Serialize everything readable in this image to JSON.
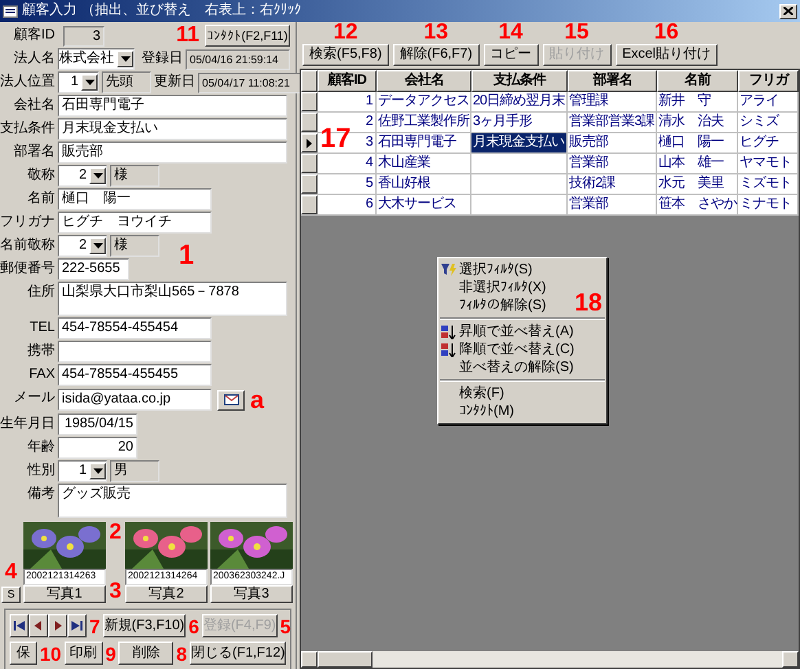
{
  "window": {
    "title": "顧客入力 （抽出、並び替え　右表上：右ｸﾘｯｸ"
  },
  "header": {
    "id_label": "顧客ID",
    "id_value": "3",
    "contact_button": "ｺﾝﾀｸﾄ(F2,F11)",
    "corp_label": "法人名",
    "corp_value": "株式会社",
    "reg_label": "登録日",
    "reg_value": "05/04/16 21:59:14",
    "pos_label": "法人位置",
    "pos_value": "1",
    "pos_text": "先頭",
    "upd_label": "更新日",
    "upd_value": "05/04/17 11:08:21"
  },
  "fields": [
    {
      "label": "会社名",
      "value": "石田専門電子",
      "kind": "long"
    },
    {
      "label": "支払条件",
      "value": "月末現金支払い",
      "kind": "long"
    },
    {
      "label": "部署名",
      "value": "販売部",
      "kind": "long"
    },
    {
      "label": "敬称",
      "value": "2",
      "text": "様",
      "kind": "combo"
    },
    {
      "label": "名前",
      "value": "樋口　陽一",
      "kind": "medium"
    },
    {
      "label": "フリガナ",
      "value": "ヒグチ　ヨウイチ",
      "kind": "medium"
    },
    {
      "label": "名前敬称",
      "value": "2",
      "text": "様",
      "kind": "combo"
    },
    {
      "label": "郵便番号",
      "value": "222-5655",
      "kind": "short"
    },
    {
      "label": "住所",
      "value": "山梨県大口市梨山565－7878",
      "kind": "area"
    },
    {
      "label": "TEL",
      "value": "454-78554-455454",
      "kind": "medium"
    },
    {
      "label": "携帯",
      "kind": "medium"
    },
    {
      "label": "FAX",
      "value": "454-78554-455455",
      "kind": "medium"
    },
    {
      "label": "メール",
      "value": "isida@yataa.co.jp",
      "kind": "mail"
    },
    {
      "label": "生年月日",
      "value": "1985/04/15",
      "kind": "number"
    },
    {
      "label": "年齢",
      "value": "20",
      "kind": "number"
    },
    {
      "label": "性別",
      "value": "1",
      "text": "男",
      "kind": "combo"
    },
    {
      "label": "備考",
      "value": "グッズ販売",
      "kind": "area"
    }
  ],
  "photos": [
    {
      "file": "2002121314263",
      "button": "写真1"
    },
    {
      "file": "2002121314264",
      "button": "写真2"
    },
    {
      "file": "200362303242.J",
      "button": "写真3"
    }
  ],
  "s_button": "S",
  "buttons": [
    {
      "label": "新規(F3,F10)",
      "disabled": false
    },
    {
      "label": "登録(F4,F9)",
      "disabled": true
    },
    {
      "label": "保",
      "disabled": false
    },
    {
      "label": "印刷",
      "disabled": false
    },
    {
      "label": "削除",
      "disabled": false
    },
    {
      "label": "閉じる(F1,F12)",
      "disabled": false
    }
  ],
  "toolbar": [
    {
      "label": "検索(F5,F8)",
      "disabled": false
    },
    {
      "label": "解除(F6,F7)",
      "disabled": false
    },
    {
      "label": "コピー",
      "disabled": false
    },
    {
      "label": "貼り付け",
      "disabled": true
    },
    {
      "label": "Excel貼り付け",
      "disabled": false
    }
  ],
  "table": {
    "columns": [
      "顧客ID",
      "会社名",
      "支払条件",
      "部署名",
      "名前",
      "フリガ"
    ],
    "rows": [
      {
        "current": false,
        "cells": [
          {
            "text": "1",
            "selected": false
          },
          {
            "text": "データアクセス",
            "selected": false
          },
          {
            "text": "20日締め翌月末",
            "selected": false
          },
          {
            "text": "管理課",
            "selected": false
          },
          {
            "text": "新井　守",
            "selected": false
          },
          {
            "text": "アライ",
            "selected": false
          }
        ]
      },
      {
        "current": false,
        "cells": [
          {
            "text": "2",
            "selected": false
          },
          {
            "text": "佐野工業製作所",
            "selected": false
          },
          {
            "text": "3ヶ月手形",
            "selected": false
          },
          {
            "text": "営業部営業3課",
            "selected": false
          },
          {
            "text": "清水　治夫",
            "selected": false
          },
          {
            "text": "シミズ",
            "selected": false
          }
        ]
      },
      {
        "current": true,
        "cells": [
          {
            "text": "3",
            "selected": false
          },
          {
            "text": "石田専門電子",
            "selected": false
          },
          {
            "text": "月末現金支払い",
            "selected": true
          },
          {
            "text": "販売部",
            "selected": false
          },
          {
            "text": "樋口　陽一",
            "selected": false
          },
          {
            "text": "ヒグチ",
            "selected": false
          }
        ]
      },
      {
        "current": false,
        "cells": [
          {
            "text": "4",
            "selected": false
          },
          {
            "text": "木山産業",
            "selected": false
          },
          {
            "text": "",
            "selected": false
          },
          {
            "text": "営業部",
            "selected": false
          },
          {
            "text": "山本　雄一",
            "selected": false
          },
          {
            "text": "ヤマモト",
            "selected": false
          }
        ]
      },
      {
        "current": false,
        "cells": [
          {
            "text": "5",
            "selected": false
          },
          {
            "text": "香山好根",
            "selected": false
          },
          {
            "text": "",
            "selected": false
          },
          {
            "text": "技術2課",
            "selected": false
          },
          {
            "text": "水元　美里",
            "selected": false
          },
          {
            "text": "ミズモト",
            "selected": false
          }
        ]
      },
      {
        "current": false,
        "cells": [
          {
            "text": "6",
            "selected": false
          },
          {
            "text": "大木サービス",
            "selected": false
          },
          {
            "text": "",
            "selected": false
          },
          {
            "text": "営業部",
            "selected": false
          },
          {
            "text": "笹本　さやか",
            "selected": false
          },
          {
            "text": "ミナモト",
            "selected": false
          }
        ]
      }
    ]
  },
  "context_menu": [
    {
      "kind": "filter",
      "label": "選択ﾌｨﾙﾀ(S)"
    },
    {
      "kind": "item",
      "label": "非選択ﾌｨﾙﾀ(X)"
    },
    {
      "kind": "item",
      "label": "ﾌｨﾙﾀの解除(S)"
    },
    {
      "kind": "separator"
    },
    {
      "kind": "sort_asc",
      "label": "昇順で並べ替え(A)"
    },
    {
      "kind": "sort_desc",
      "label": "降順で並べ替え(C)"
    },
    {
      "kind": "item",
      "label": "並べ替えの解除(S)"
    },
    {
      "kind": "separator"
    },
    {
      "kind": "item",
      "label": "検索(F)"
    },
    {
      "kind": "item",
      "label": "ｺﾝﾀｸﾄ(M)"
    }
  ],
  "annotations": [
    "11",
    "1",
    "a",
    "2",
    "4",
    "3",
    "7",
    "6",
    "5",
    "10",
    "9",
    "8",
    "12",
    "13",
    "14",
    "15",
    "16",
    "17",
    "18"
  ]
}
